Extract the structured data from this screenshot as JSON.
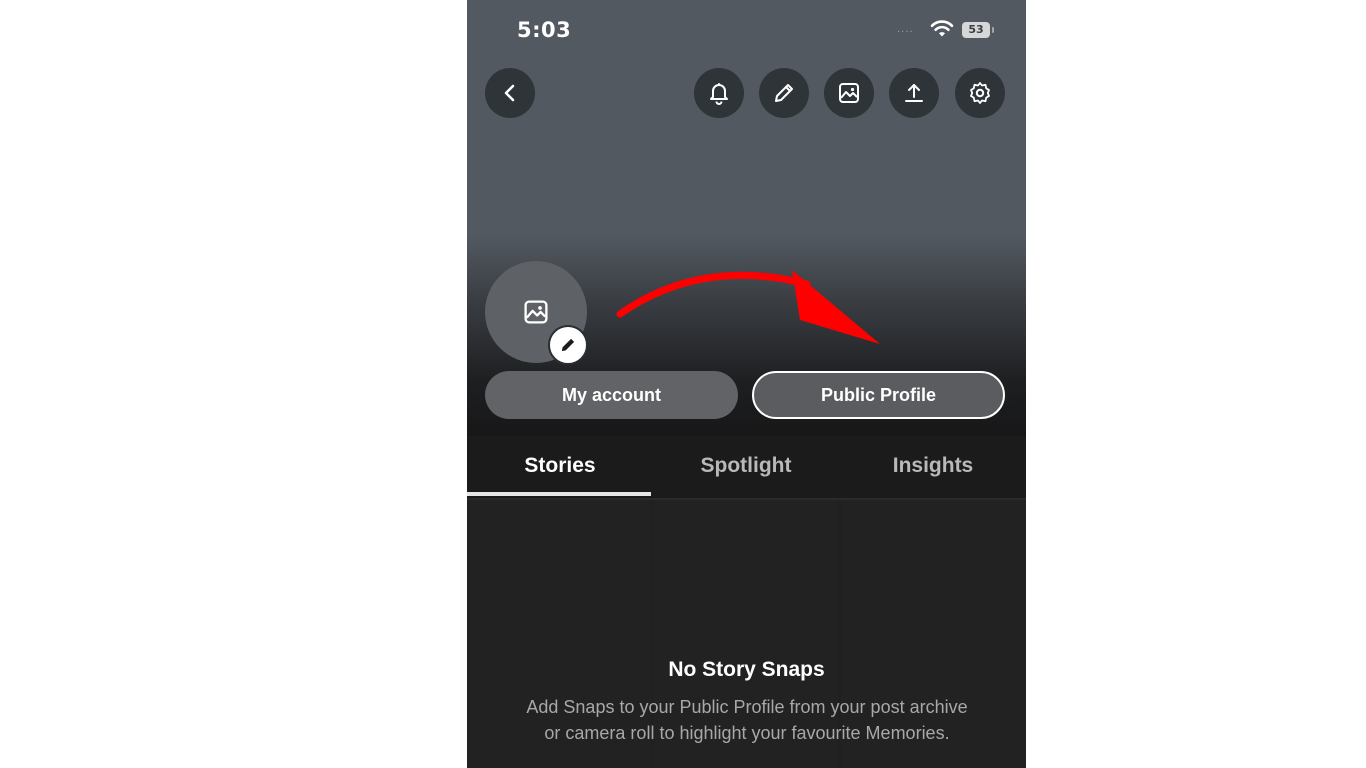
{
  "status_bar": {
    "time": "5:03",
    "signal_dots": "....",
    "battery": "53"
  },
  "top_bar": {
    "icons": [
      "back-chevron-icon",
      "bell-icon",
      "pencil-icon",
      "image-icon",
      "share-upload-icon",
      "gear-icon"
    ]
  },
  "profile": {
    "avatar_icon": "image-icon",
    "edit_icon": "pencil-icon",
    "my_account_label": "My account",
    "public_profile_label": "Public Profile"
  },
  "annotation": {
    "arrow_color": "#ff0000"
  },
  "tabs": [
    {
      "label": "Stories",
      "active": true
    },
    {
      "label": "Spotlight",
      "active": false
    },
    {
      "label": "Insights",
      "active": false
    }
  ],
  "empty_state": {
    "title": "No Story Snaps",
    "description": "Add Snaps to your Public Profile from your post archive or camera roll to highlight your favourite Memories."
  }
}
